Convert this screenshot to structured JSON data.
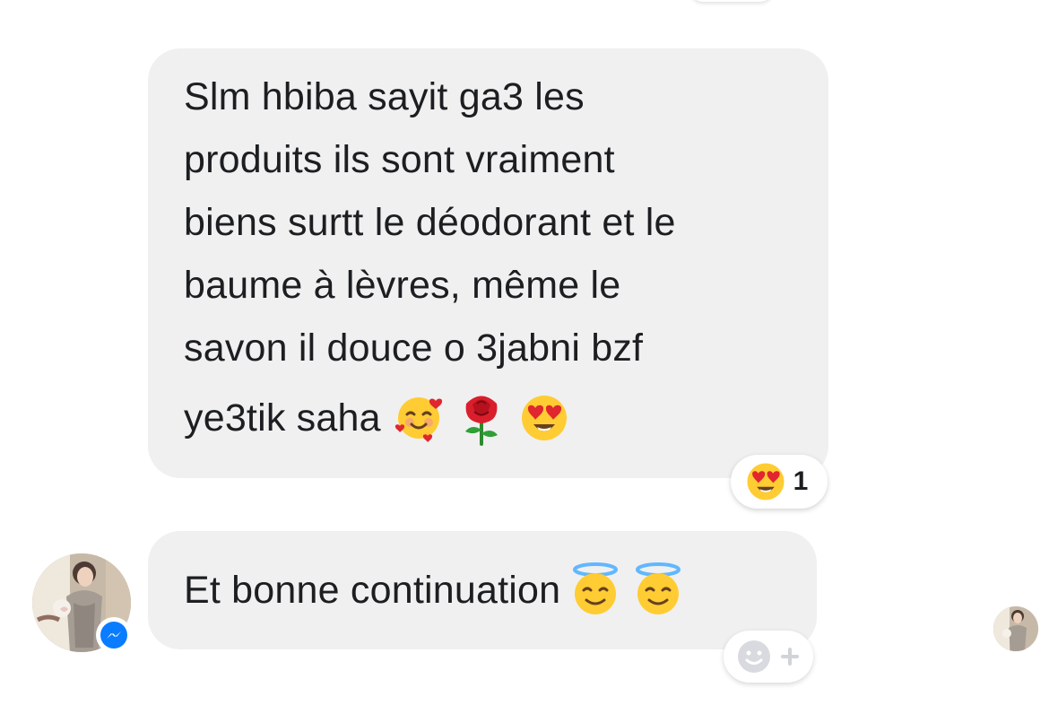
{
  "conversation": {
    "message_1": {
      "lines": [
        "Slm hbiba sayit ga3 les",
        "produits ils sont vraiment",
        "biens surtt le déodorant et le",
        "baume à lèvres, même le",
        "savon il douce o 3jabni bzf"
      ],
      "last_line_text": "ye3tik saha",
      "emojis": [
        "smiling-face-with-hearts",
        "rose",
        "heart-eyes-face"
      ],
      "reaction": {
        "emoji": "heart-eyes-face",
        "count": "1"
      }
    },
    "message_2": {
      "text": "Et bonne continuation",
      "emojis": [
        "smiling-face-with-halo",
        "smiling-face-with-halo"
      ]
    },
    "add_reaction": {
      "icon": "add-reaction-icon"
    }
  },
  "colors": {
    "bubble_background": "#f0f0f0",
    "text": "#1c1e21",
    "messenger_blue": "#0a7cff",
    "emoji_yellow": "#ffcc33",
    "emoji_red": "#e0262f"
  }
}
